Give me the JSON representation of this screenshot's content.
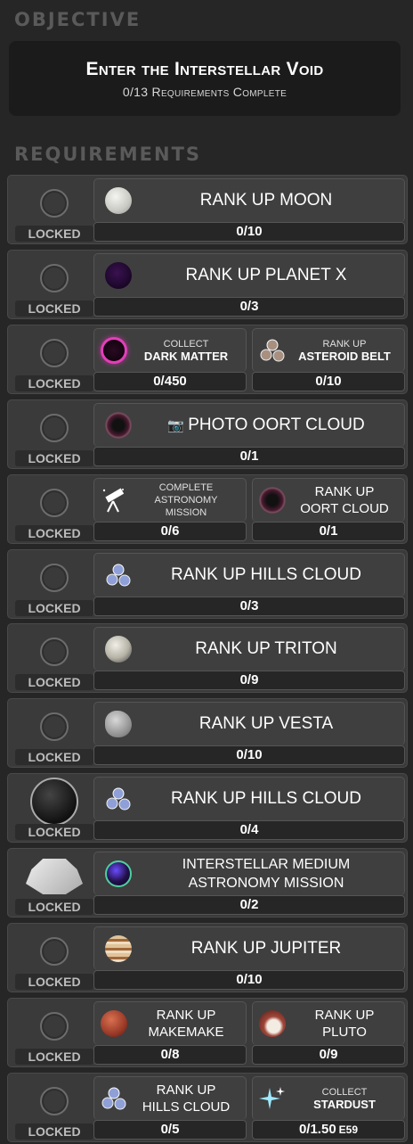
{
  "objective": {
    "section_title": "OBJECTIVE",
    "title": "Enter the Interstellar Void",
    "subtitle": "0/13 Requirements Complete"
  },
  "requirements": {
    "section_title": "REQUIREMENTS",
    "locked_label": "LOCKED",
    "rows": [
      {
        "tiles": [
          {
            "icon": "moon-icon",
            "label": "RANK UP MOON",
            "progress": "0/10"
          }
        ]
      },
      {
        "tiles": [
          {
            "icon": "planet-x-icon",
            "label": "RANK UP PLANET X",
            "progress": "0/3"
          }
        ]
      },
      {
        "tiles": [
          {
            "icon": "dark-matter-icon",
            "label_small": "COLLECT",
            "label_big": "DARK MATTER",
            "progress": "0/450"
          },
          {
            "icon": "asteroid-belt-icon",
            "label_small": "RANK UP",
            "label_big": "ASTEROID BELT",
            "progress": "0/10"
          }
        ]
      },
      {
        "tiles": [
          {
            "icon": "oort-cloud-icon",
            "camera_icon": "camera-icon",
            "label": "PHOTO OORT CLOUD",
            "progress": "0/1"
          }
        ]
      },
      {
        "tiles": [
          {
            "icon": "telescope-icon",
            "label_lines": [
              "COMPLETE",
              "ASTRONOMY",
              "MISSION"
            ],
            "progress": "0/6"
          },
          {
            "icon": "oort-cloud-icon",
            "label_lines": [
              "RANK UP",
              "OORT CLOUD"
            ],
            "progress": "0/1"
          }
        ]
      },
      {
        "tiles": [
          {
            "icon": "hills-cloud-icon",
            "label": "RANK UP HILLS CLOUD",
            "progress": "0/3"
          }
        ]
      },
      {
        "tiles": [
          {
            "icon": "triton-icon",
            "label": "RANK UP TRITON",
            "progress": "0/9"
          }
        ]
      },
      {
        "tiles": [
          {
            "icon": "vesta-icon",
            "label": "RANK UP VESTA",
            "progress": "0/10"
          }
        ]
      },
      {
        "lock_icon": "bubble-lock-icon",
        "tiles": [
          {
            "icon": "hills-cloud-icon",
            "label": "RANK UP HILLS CLOUD",
            "progress": "0/4"
          }
        ]
      },
      {
        "lock_icon": "crystal-lock-icon",
        "tiles": [
          {
            "icon": "interstellar-medium-icon",
            "label_lines": [
              "INTERSTELLAR MEDIUM",
              "ASTRONOMY MISSION"
            ],
            "progress": "0/2"
          }
        ]
      },
      {
        "tiles": [
          {
            "icon": "jupiter-icon",
            "label": "RANK UP JUPITER",
            "progress": "0/10"
          }
        ]
      },
      {
        "tiles": [
          {
            "icon": "makemake-icon",
            "label_lines": [
              "RANK UP",
              "MAKEMAKE"
            ],
            "progress": "0/8"
          },
          {
            "icon": "pluto-icon",
            "label_lines": [
              "RANK UP",
              "PLUTO"
            ],
            "progress": "0/9"
          }
        ]
      },
      {
        "tiles": [
          {
            "icon": "hills-cloud-icon",
            "label_lines": [
              "RANK UP",
              "HILLS CLOUD"
            ],
            "progress": "0/5"
          },
          {
            "icon": "stardust-icon",
            "label_small": "COLLECT",
            "label_big": "STARDUST",
            "progress": "0/1.50",
            "progress_suffix": "E59"
          }
        ]
      }
    ]
  }
}
